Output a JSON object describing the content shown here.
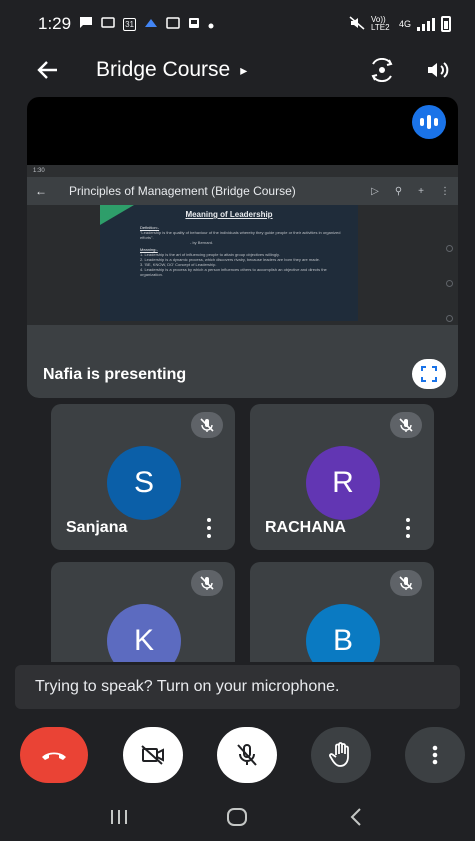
{
  "status_bar": {
    "time": "1:29",
    "notif_icons": [
      "chat-bubble-icon",
      "cast-icon",
      "calendar-31-icon",
      "app-icon",
      "gallery-icon",
      "photo-icon",
      "dot-icon"
    ],
    "calendar_day": "31",
    "network_label": "Vo)) LTE2",
    "network_type": "4G"
  },
  "app_bar": {
    "title": "Bridge Course",
    "title_chevron": "▸"
  },
  "presentation": {
    "presenter_text": "Nafia is presenting",
    "shared_screen": {
      "status_time": "1:30",
      "app_title": "Principles of Management (Bridge Course)",
      "slide_heading": "Meaning of Leadership",
      "definition_heading": "Definition:-",
      "definition_text": "\"Leadership is the quality of behaviour of the individuals whereby they guide people or their activities in organized efforts\".",
      "definition_author": "- by Bernard.",
      "meaning_heading": "Meaning:-",
      "points": [
        "1. Leadership is the art of influencing people to attain group objectives willingly.",
        "2. Leadership is a dynamic process, which discovers rivalry, because leaders are born they are made.",
        "3. 'BE, KNOW, DO' Concept of Leadership.",
        "4. Leadership is a process by which a person influences others to accomplish an objective and directs the organization."
      ]
    }
  },
  "participants": [
    {
      "initial": "S",
      "name": "Sanjana",
      "avatar_color": "#0b5fa8",
      "muted": true
    },
    {
      "initial": "R",
      "name": "RACHANA",
      "avatar_color": "#6236b3",
      "muted": true
    },
    {
      "initial": "K",
      "name": "",
      "avatar_color": "#5c6bc0",
      "muted": true
    },
    {
      "initial": "B",
      "name": "",
      "avatar_color": "#0a7ac2",
      "muted": true
    }
  ],
  "toast": {
    "text": "Trying to speak? Turn on your microphone."
  },
  "colors": {
    "background": "#202124",
    "end_call": "#ea4335",
    "active_speaker": "#1a73e8"
  }
}
